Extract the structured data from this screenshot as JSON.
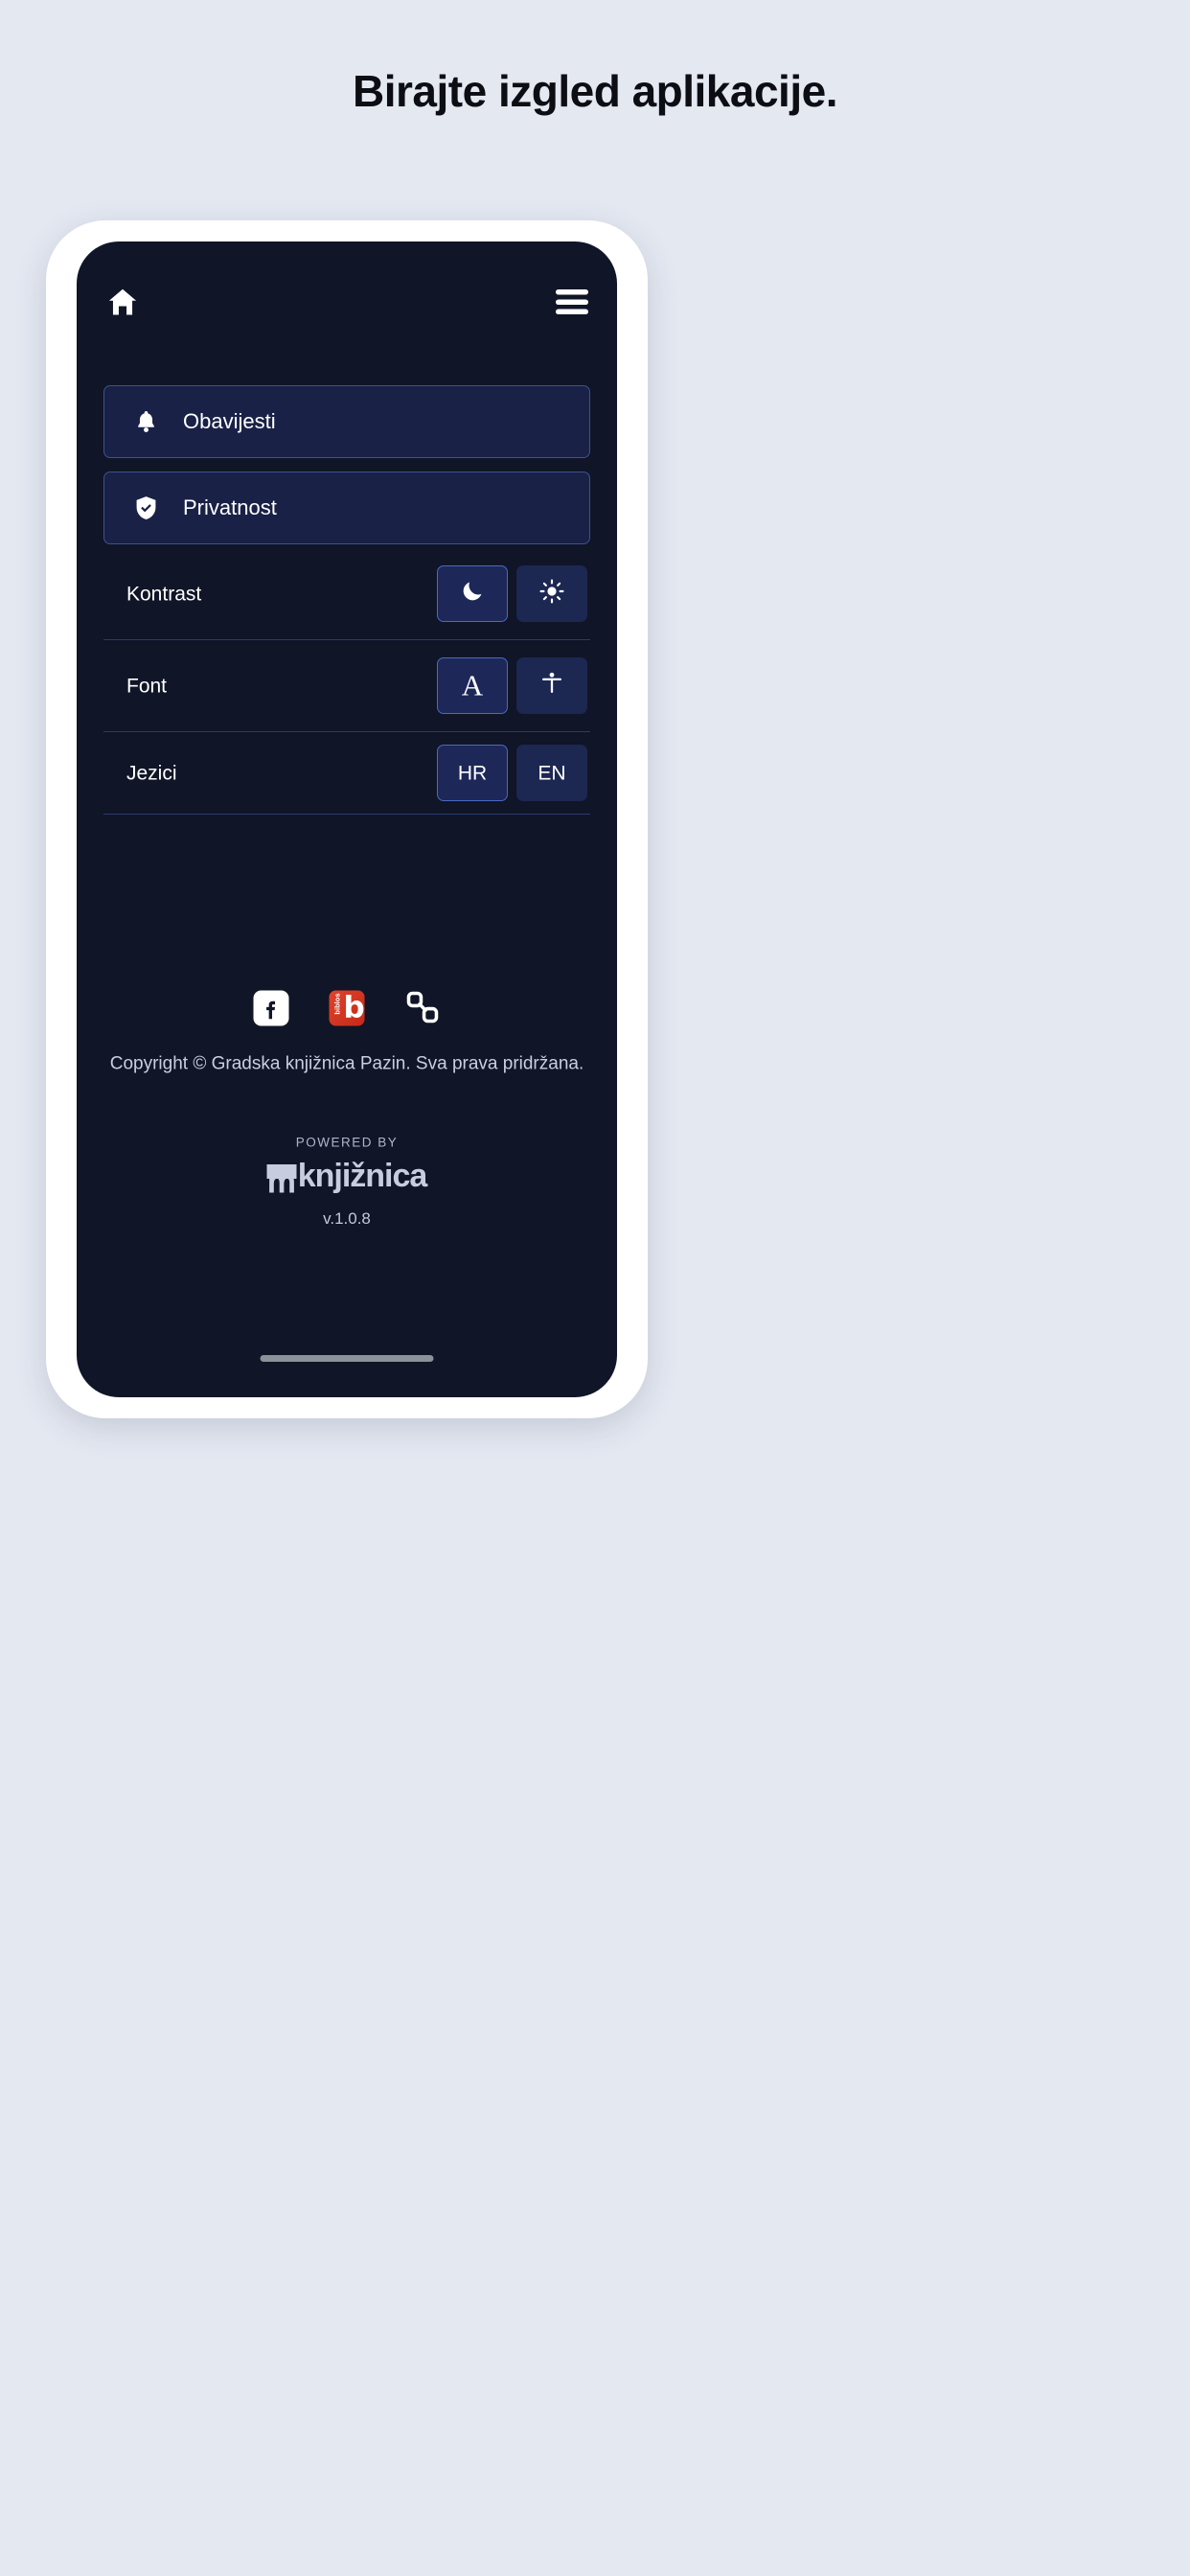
{
  "page": {
    "title": "Birajte izgled aplikacije.",
    "background_color": "#e4e8f1"
  },
  "phone": {
    "frame_color": "#ffffff",
    "screen_background": "#101527"
  },
  "appbar": {
    "home_icon": "home-icon",
    "menu_icon": "hamburger-menu-icon"
  },
  "nav_cards": [
    {
      "label": "Obavijesti",
      "icon": "bell-icon"
    },
    {
      "label": "Privatnost",
      "icon": "shield-check-icon"
    }
  ],
  "settings": [
    {
      "label": "Kontrast",
      "options": [
        {
          "value": "dark",
          "icon": "moon-icon",
          "text": "",
          "selected": true
        },
        {
          "value": "light",
          "icon": "sun-icon",
          "text": "",
          "selected": false
        }
      ]
    },
    {
      "label": "Font",
      "options": [
        {
          "value": "serif",
          "icon": "letter-a-serif-icon",
          "text": "A",
          "selected": true
        },
        {
          "value": "accessible",
          "icon": "accessibility-person-icon",
          "text": "",
          "selected": false
        }
      ]
    },
    {
      "label": "Jezici",
      "options": [
        {
          "value": "hr",
          "icon": "",
          "text": "HR",
          "selected": true
        },
        {
          "value": "en",
          "icon": "",
          "text": "EN",
          "selected": false
        }
      ]
    }
  ],
  "socials": [
    {
      "name": "facebook",
      "icon": "facebook-icon"
    },
    {
      "name": "biblos",
      "icon": "biblos-icon",
      "wordmark": "biblos",
      "letter": "b"
    },
    {
      "name": "link",
      "icon": "link-chain-icon"
    }
  ],
  "footer": {
    "copyright": "Copyright © Gradska knjižnica Pazin. Sva prava pridržana.",
    "powered_by": "POWERED BY",
    "brand_prefix": "m",
    "brand_name": "knjižnica",
    "version": "v.1.0.8"
  },
  "colors": {
    "accent_border": "#4a6ac0",
    "card_bg": "#192146",
    "card_border": "#3b5390",
    "option_bg": "#1c2752",
    "divider": "#2b3a6b",
    "biblos_red": "#d63520",
    "home_indicator": "#8d9199"
  }
}
